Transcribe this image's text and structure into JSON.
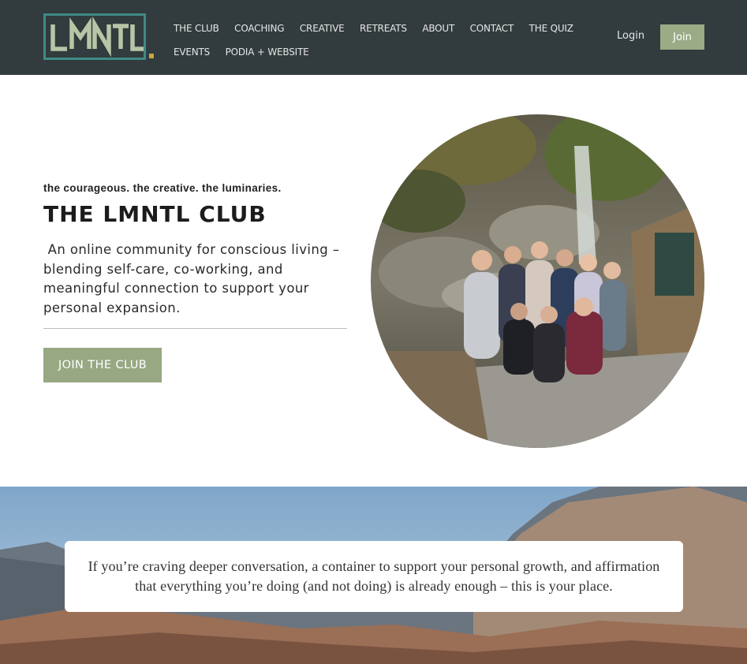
{
  "header": {
    "logo_text": "LMNTL.",
    "nav_row1": [
      "THE CLUB",
      "COACHING",
      "CREATIVE",
      "RETREATS",
      "ABOUT",
      "CONTACT",
      "THE QUIZ"
    ],
    "nav_row2": [
      "EVENTS",
      "PODIA + WEBSITE"
    ],
    "login_label": "Login",
    "join_label": "Join"
  },
  "hero": {
    "tagline": "the courageous. the creative. the luminaries.",
    "title": "THE LMNTL CLUB",
    "description": " An online community for conscious living – blending self-care, co-working, and meaningful connection to support your personal expansion.",
    "cta_label": "JOIN THE CLUB"
  },
  "banner": {
    "quote": "If you’re craving deeper conversation, a container to support your personal growth, and affirmation that everything you’re doing (and not doing) is already enough – this is your place."
  },
  "colors": {
    "header_bg": "#323b3d",
    "accent_green": "#97a883",
    "logo_teal": "#3f8a86",
    "logo_gold": "#c9a640"
  }
}
